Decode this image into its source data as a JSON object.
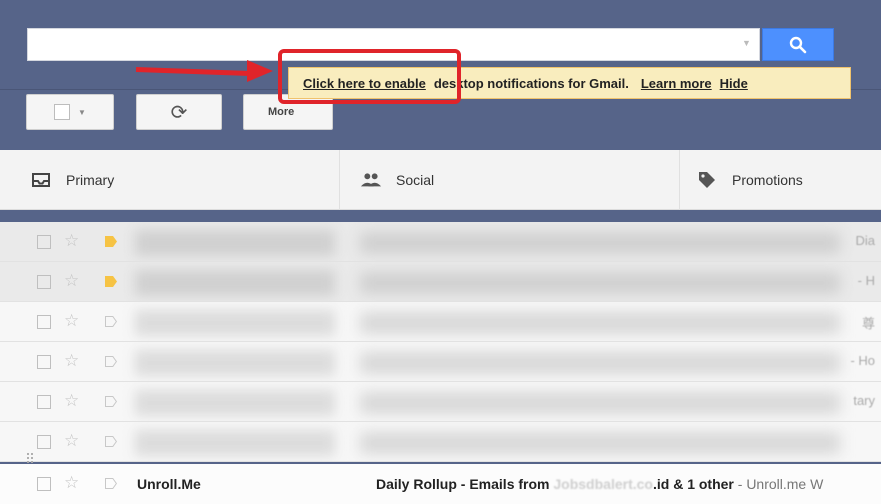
{
  "search": {
    "value": "",
    "placeholder": ""
  },
  "toolbar": {
    "more_label": "More"
  },
  "notification": {
    "enable_link": "Click here to enable",
    "message": "desktop notifications for Gmail.",
    "learn_more": "Learn more",
    "hide": "Hide"
  },
  "tabs": [
    {
      "label": "Primary",
      "icon": "inbox-icon"
    },
    {
      "label": "Social",
      "icon": "people-icon"
    },
    {
      "label": "Promotions",
      "icon": "tag-icon"
    }
  ],
  "rows": [
    {
      "tail": "Dia",
      "tag_color": "#f6c344"
    },
    {
      "tail": "- H",
      "tag_color": "#f6c344"
    },
    {
      "tail": "尊",
      "tag_color": ""
    },
    {
      "tail": "- Ho",
      "tag_color": ""
    },
    {
      "tail": "tary",
      "tag_color": ""
    }
  ],
  "last_row": {
    "sender": "Unroll.Me",
    "subject_lead": "Daily Rollup - Emails from",
    "masked_domain": "Jobsdbalert.co",
    "subject_mid": ".id & 1 other",
    "snippet": " - Unroll.me W"
  },
  "colors": {
    "header_bg": "#566489",
    "search_button": "#4d90fe",
    "notification_bg": "#f9edbe",
    "annotation_red": "#e0242a",
    "important_tag": "#f6c344"
  }
}
